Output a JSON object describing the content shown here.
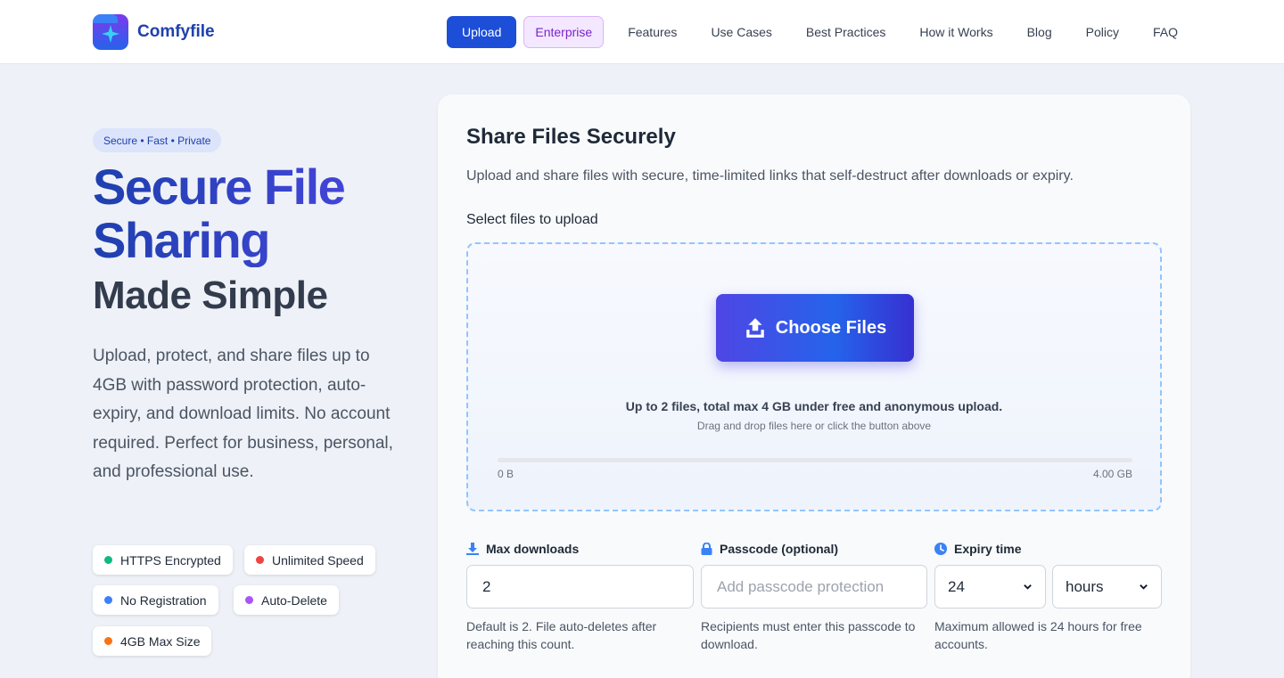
{
  "brand": {
    "name": "Comfyfile"
  },
  "nav": {
    "upload": "Upload",
    "enterprise": "Enterprise",
    "links": [
      "Features",
      "Use Cases",
      "Best Practices",
      "How it Works",
      "Blog",
      "Policy",
      "FAQ"
    ]
  },
  "hero": {
    "badge": "Secure • Fast • Private",
    "title_line1": "Secure File",
    "title_line2": "Sharing",
    "title_line3": "Made Simple",
    "description": "Upload, protect, and share files up to 4GB with password protection, auto-expiry, and download limits. No account required. Perfect for business, personal, and professional use."
  },
  "features": [
    {
      "label": "HTTPS Encrypted",
      "color": "#10b981"
    },
    {
      "label": "Unlimited Speed",
      "color": "#ef4444"
    },
    {
      "label": "No Registration",
      "color": "#3b82f6"
    },
    {
      "label": "Auto-Delete",
      "color": "#a855f7"
    },
    {
      "label": "4GB Max Size",
      "color": "#f97316"
    }
  ],
  "card": {
    "title": "Share Files Securely",
    "subtitle": "Upload and share files with secure, time-limited links that self-destruct after downloads or expiry.",
    "select_label": "Select files to upload",
    "choose_button": "Choose Files",
    "limit_text": "Up to 2 files, total max 4 GB under free and anonymous upload.",
    "hint_text": "Drag and drop files here or click the button above",
    "progress": {
      "min_label": "0 B",
      "max_label": "4.00 GB",
      "fraction": 0
    }
  },
  "form": {
    "max_downloads": {
      "label": "Max downloads",
      "value": "2",
      "help": "Default is 2. File auto-deletes after reaching this count."
    },
    "passcode": {
      "label": "Passcode (optional)",
      "placeholder": "Add passcode protection",
      "help": "Recipients must enter this passcode to download."
    },
    "expiry": {
      "label": "Expiry time",
      "value": "24",
      "unit": "hours",
      "help": "Maximum allowed is 24 hours for free accounts."
    }
  },
  "colors": {
    "primary": "#1d4ed8",
    "accent": "#4f46e5",
    "enterprise": "#7e22ce"
  }
}
